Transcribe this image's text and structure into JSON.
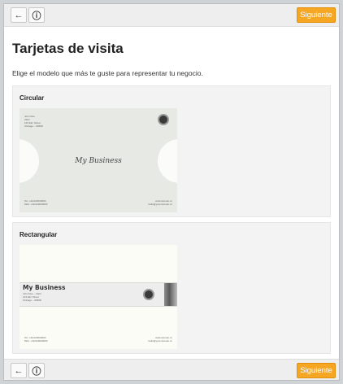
{
  "toolbar": {
    "back_icon": "arrow-left-icon",
    "info_icon": "info-icon",
    "next_label": "Siguiente"
  },
  "page": {
    "title": "Tarjetas de visita",
    "description": "Elige el modelo que más te guste para representar tu negocio."
  },
  "templates": [
    {
      "label": "Circular",
      "preview": {
        "name": "John Doe",
        "role": "CEO",
        "address1": "123 Elm Street",
        "address2": "Chicago – 60608",
        "business": "My Business",
        "tel": "Tel: +34/123020000",
        "mob": "Mob: +34/123020003",
        "web": "www.domain.cc",
        "email": "hello@your.domain.cc"
      }
    },
    {
      "label": "Rectangular",
      "preview": {
        "name": "John Doe – CEO",
        "address1": "123 Elm Street",
        "address2": "Chicago – 60608",
        "business": "My Business",
        "tel": "Tel: +34/123020000",
        "mob": "Mob: +34/123020003",
        "web": "www.domain.cc",
        "email": "hello@your.domain.cc"
      }
    }
  ],
  "colors": {
    "accent": "#f5a623",
    "toolbar": "#eeeeee",
    "panel": "#f3f3f3"
  }
}
